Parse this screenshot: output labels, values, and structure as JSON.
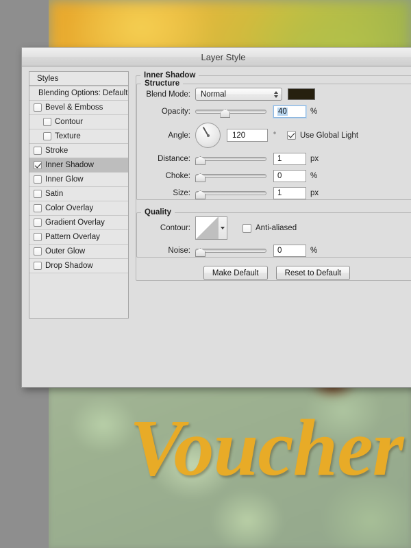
{
  "document": {
    "heading_text": "Voucher",
    "heading_color": "#e8ab27"
  },
  "dialog": {
    "title": "Layer Style"
  },
  "styles_panel": {
    "header_label": "Styles",
    "blending_options_label": "Blending Options: Default",
    "items": [
      {
        "label": "Bevel & Emboss",
        "checked": false,
        "indent": "effect",
        "selected": false
      },
      {
        "label": "Contour",
        "checked": false,
        "indent": "sub",
        "selected": false
      },
      {
        "label": "Texture",
        "checked": false,
        "indent": "sub",
        "selected": false
      },
      {
        "label": "Stroke",
        "checked": false,
        "indent": "effect",
        "selected": false
      },
      {
        "label": "Inner Shadow",
        "checked": true,
        "indent": "effect",
        "selected": true
      },
      {
        "label": "Inner Glow",
        "checked": false,
        "indent": "effect",
        "selected": false
      },
      {
        "label": "Satin",
        "checked": false,
        "indent": "effect",
        "selected": false
      },
      {
        "label": "Color Overlay",
        "checked": false,
        "indent": "effect",
        "selected": false
      },
      {
        "label": "Gradient Overlay",
        "checked": false,
        "indent": "effect",
        "selected": false
      },
      {
        "label": "Pattern Overlay",
        "checked": false,
        "indent": "effect",
        "selected": false
      },
      {
        "label": "Outer Glow",
        "checked": false,
        "indent": "effect",
        "selected": false
      },
      {
        "label": "Drop Shadow",
        "checked": false,
        "indent": "effect",
        "selected": false
      }
    ]
  },
  "inner_shadow": {
    "group_label": "Inner Shadow",
    "structure": {
      "group_label": "Structure",
      "blend_mode": {
        "label": "Blend Mode:",
        "value": "Normal"
      },
      "shadow_color": "#26200f",
      "opacity": {
        "label": "Opacity:",
        "value": "40",
        "unit": "%",
        "slider_pct": 40
      },
      "angle": {
        "label": "Angle:",
        "value": "120",
        "unit": "°"
      },
      "use_global_light": {
        "label": "Use Global Light",
        "checked": true
      },
      "distance": {
        "label": "Distance:",
        "value": "1",
        "unit": "px",
        "slider_pct": 0
      },
      "choke": {
        "label": "Choke:",
        "value": "0",
        "unit": "%",
        "slider_pct": 0
      },
      "size": {
        "label": "Size:",
        "value": "1",
        "unit": "px",
        "slider_pct": 0
      }
    },
    "quality": {
      "group_label": "Quality",
      "contour": {
        "label": "Contour:"
      },
      "anti_aliased": {
        "label": "Anti-aliased",
        "checked": false
      },
      "noise": {
        "label": "Noise:",
        "value": "0",
        "unit": "%",
        "slider_pct": 0
      }
    },
    "buttons": {
      "make_default": "Make Default",
      "reset_to_default": "Reset to Default"
    }
  }
}
